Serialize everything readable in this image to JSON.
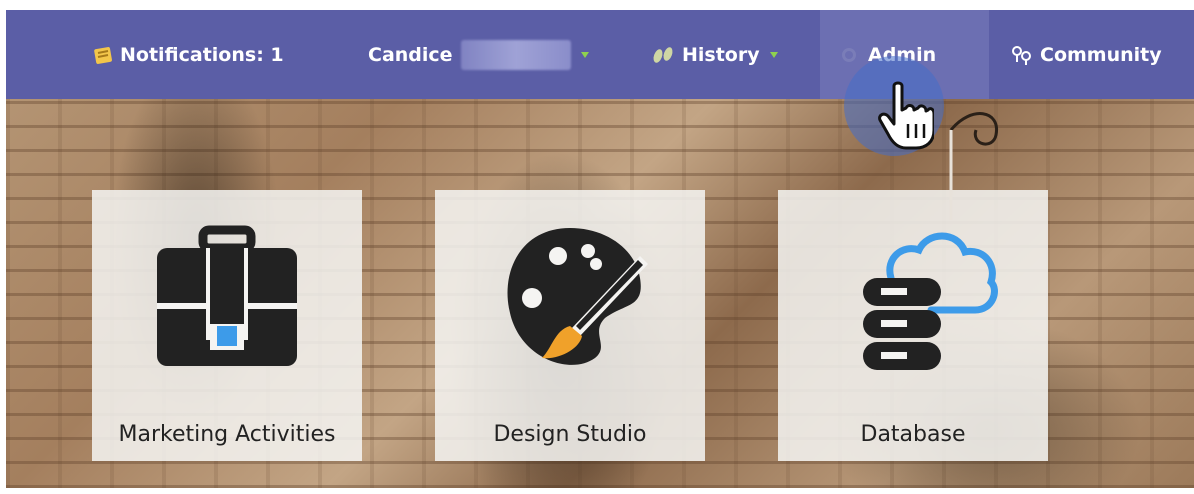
{
  "nav": {
    "notifications_label": "Notifications: 1",
    "user_label": "Candice",
    "history_label": "History",
    "admin_label": "Admin",
    "community_label": "Community"
  },
  "tiles": [
    {
      "label": "Marketing Activities",
      "icon": "briefcase-icon"
    },
    {
      "label": "Design Studio",
      "icon": "palette-icon"
    },
    {
      "label": "Database",
      "icon": "database-cloud-icon"
    }
  ],
  "colors": {
    "navbar": "#5b5ea6",
    "admin_active": "#6c6fb2",
    "caret": "#8fd14f",
    "accent_blue": "#3d9be9",
    "accent_orange": "#f0a12a"
  }
}
